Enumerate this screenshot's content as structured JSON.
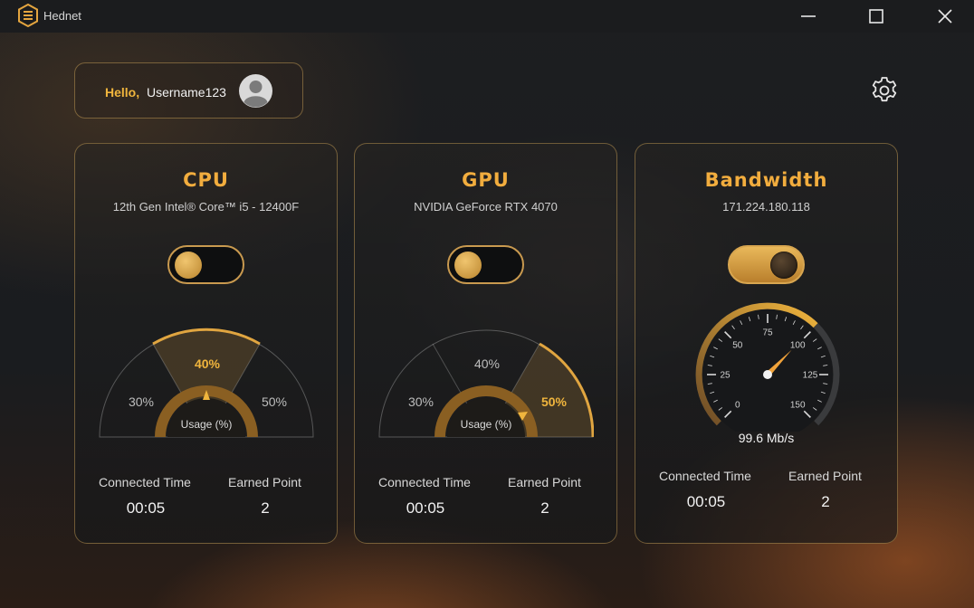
{
  "window": {
    "title": "Hednet"
  },
  "header": {
    "hello": "Hello,",
    "username": "Username123"
  },
  "cards": {
    "cpu": {
      "title": "CPU",
      "subtitle": "12th Gen Intel® Core™ i5 - 12400F",
      "toggle_on": false,
      "gauge": {
        "options": [
          "30%",
          "40%",
          "50%"
        ],
        "selected": "40%",
        "center_label": "Usage (%)"
      },
      "connected_time_label": "Connected Time",
      "connected_time": "00:05",
      "earned_point_label": "Earned Point",
      "earned_point": "2"
    },
    "gpu": {
      "title": "GPU",
      "subtitle": "NVIDIA GeForce RTX 4070",
      "toggle_on": false,
      "gauge": {
        "options": [
          "30%",
          "40%",
          "50%"
        ],
        "selected": "50%",
        "center_label": "Usage (%)"
      },
      "connected_time_label": "Connected Time",
      "connected_time": "00:05",
      "earned_point_label": "Earned Point",
      "earned_point": "2"
    },
    "bandwidth": {
      "title": "Bandwidth",
      "subtitle": "171.224.180.118",
      "toggle_on": true,
      "speedometer": {
        "ticks": [
          "0",
          "25",
          "50",
          "75",
          "100",
          "125",
          "150"
        ],
        "min": 0,
        "max": 150,
        "value": 99.6
      },
      "speed": "99.6 Mb/s",
      "connected_time_label": "Connected Time",
      "connected_time": "00:05",
      "earned_point_label": "Earned Point",
      "earned_point": "2"
    }
  },
  "colors": {
    "accent": "#f0b53d",
    "card_border": "#d6aa5a",
    "background": "#15181c"
  },
  "icons": {
    "logo": "hednet-logo-icon",
    "minimize": "minimize-icon",
    "maximize": "maximize-icon",
    "close": "close-icon",
    "avatar": "user-avatar-icon",
    "settings": "gear-icon"
  }
}
